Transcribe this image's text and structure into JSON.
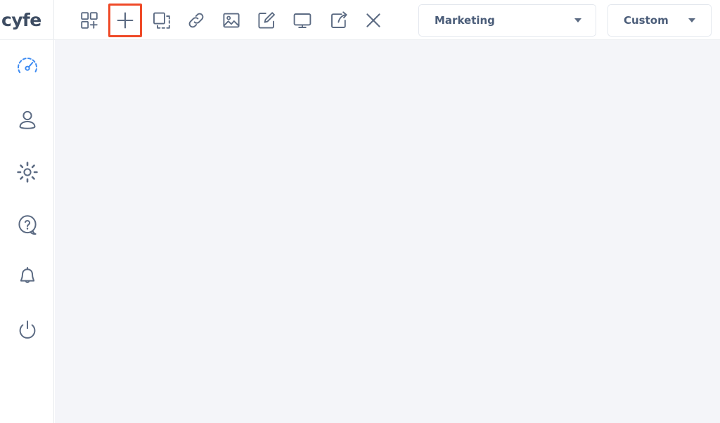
{
  "app": {
    "name": "cyfe",
    "logo_text": "cyfe",
    "background_color": "#f4f5f9",
    "accent_color": "#3d8bf2",
    "highlight_color": "#ef4a28",
    "icon_color": "#5c6b83"
  },
  "sidebar": {
    "items": [
      {
        "name": "dashboards",
        "icon": "gauge-icon",
        "active": true
      },
      {
        "name": "account",
        "icon": "user-icon",
        "active": false
      },
      {
        "name": "settings",
        "icon": "gear-icon",
        "active": false
      },
      {
        "name": "help",
        "icon": "question-bubble-icon",
        "active": false
      },
      {
        "name": "notifications",
        "icon": "bell-icon",
        "active": false
      },
      {
        "name": "logout",
        "icon": "power-icon",
        "active": false
      }
    ]
  },
  "toolbar": {
    "buttons": [
      {
        "name": "add-widget",
        "icon": "grid-plus-icon",
        "highlighted": false
      },
      {
        "name": "add",
        "icon": "plus-icon",
        "highlighted": true
      },
      {
        "name": "duplicate",
        "icon": "copy-icon",
        "highlighted": false
      },
      {
        "name": "link",
        "icon": "link-icon",
        "highlighted": false
      },
      {
        "name": "image",
        "icon": "image-icon",
        "highlighted": false
      },
      {
        "name": "edit",
        "icon": "pencil-square-icon",
        "highlighted": false
      },
      {
        "name": "tv-mode",
        "icon": "monitor-icon",
        "highlighted": false
      },
      {
        "name": "share",
        "icon": "share-external-icon",
        "highlighted": false
      },
      {
        "name": "close",
        "icon": "close-x-icon",
        "highlighted": false
      }
    ]
  },
  "selects": {
    "dashboard": {
      "value": "Marketing",
      "caret_icon": "chevron-down-icon"
    },
    "date_range": {
      "value": "Custom",
      "caret_icon": "chevron-down-icon"
    }
  },
  "content": {
    "empty": true
  }
}
